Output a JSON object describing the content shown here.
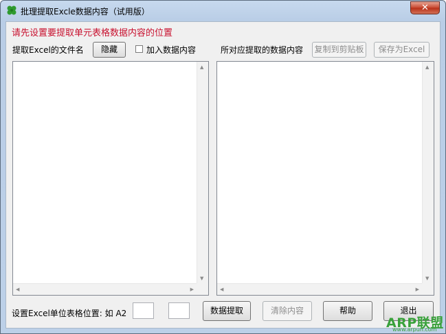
{
  "window": {
    "title": "批理提取Excle数据内容（试用版）",
    "close_glyph": "✕"
  },
  "hint": "请先设置要提取单元表格数据内容的位置",
  "left_panel": {
    "label": "提取Excel的文件名",
    "hide_button": "隐藏",
    "append_checkbox": {
      "label": "加入数据内容",
      "checked": false
    }
  },
  "right_panel": {
    "label": "所对应提取的数据内容",
    "copy_button": "复制到剪贴板",
    "save_button": "保存为Excel"
  },
  "footer": {
    "cell_label": "设置Excel单位表格位置: 如 A2",
    "extract_button": "数据提取",
    "clear_button": "清除内容",
    "help_button": "帮助",
    "exit_button": "退出"
  },
  "watermark": {
    "brand": "ARP联盟",
    "url": "www.arpun.com"
  },
  "colors": {
    "hint": "#c8102e",
    "watermark": "#39a13b",
    "title_bar": "#b9cde6"
  }
}
